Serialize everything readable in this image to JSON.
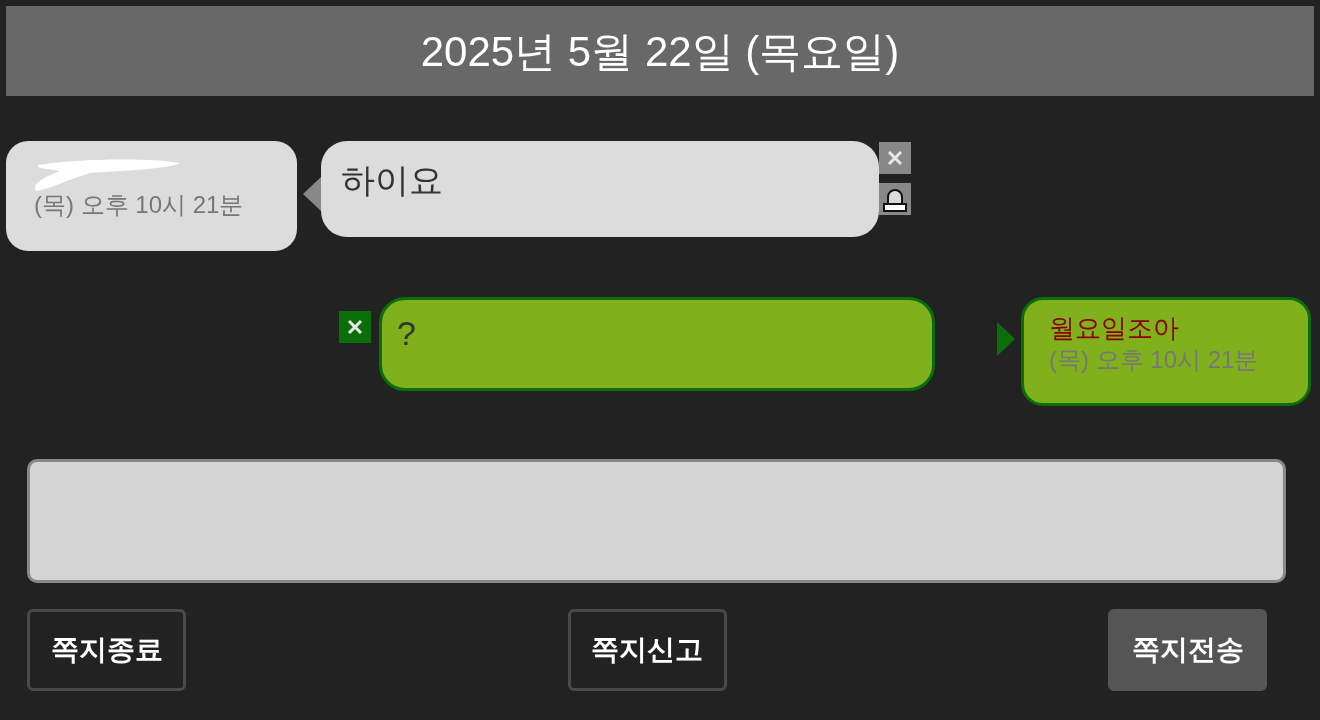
{
  "header": {
    "date": "2025년 5월 22일 (목요일)"
  },
  "messages": [
    {
      "kind": "received",
      "time": "(목) 오후 10시 21분",
      "text": "하이요",
      "name_redacted": true
    },
    {
      "kind": "sent",
      "name": "월요일조아",
      "time": "(목) 오후 10시 21분",
      "text": "?"
    }
  ],
  "buttons": [
    {
      "label": "쪽지종료",
      "primary": false
    },
    {
      "label": "쪽지신고",
      "primary": false
    },
    {
      "label": "쪽지전송",
      "primary": true
    }
  ]
}
